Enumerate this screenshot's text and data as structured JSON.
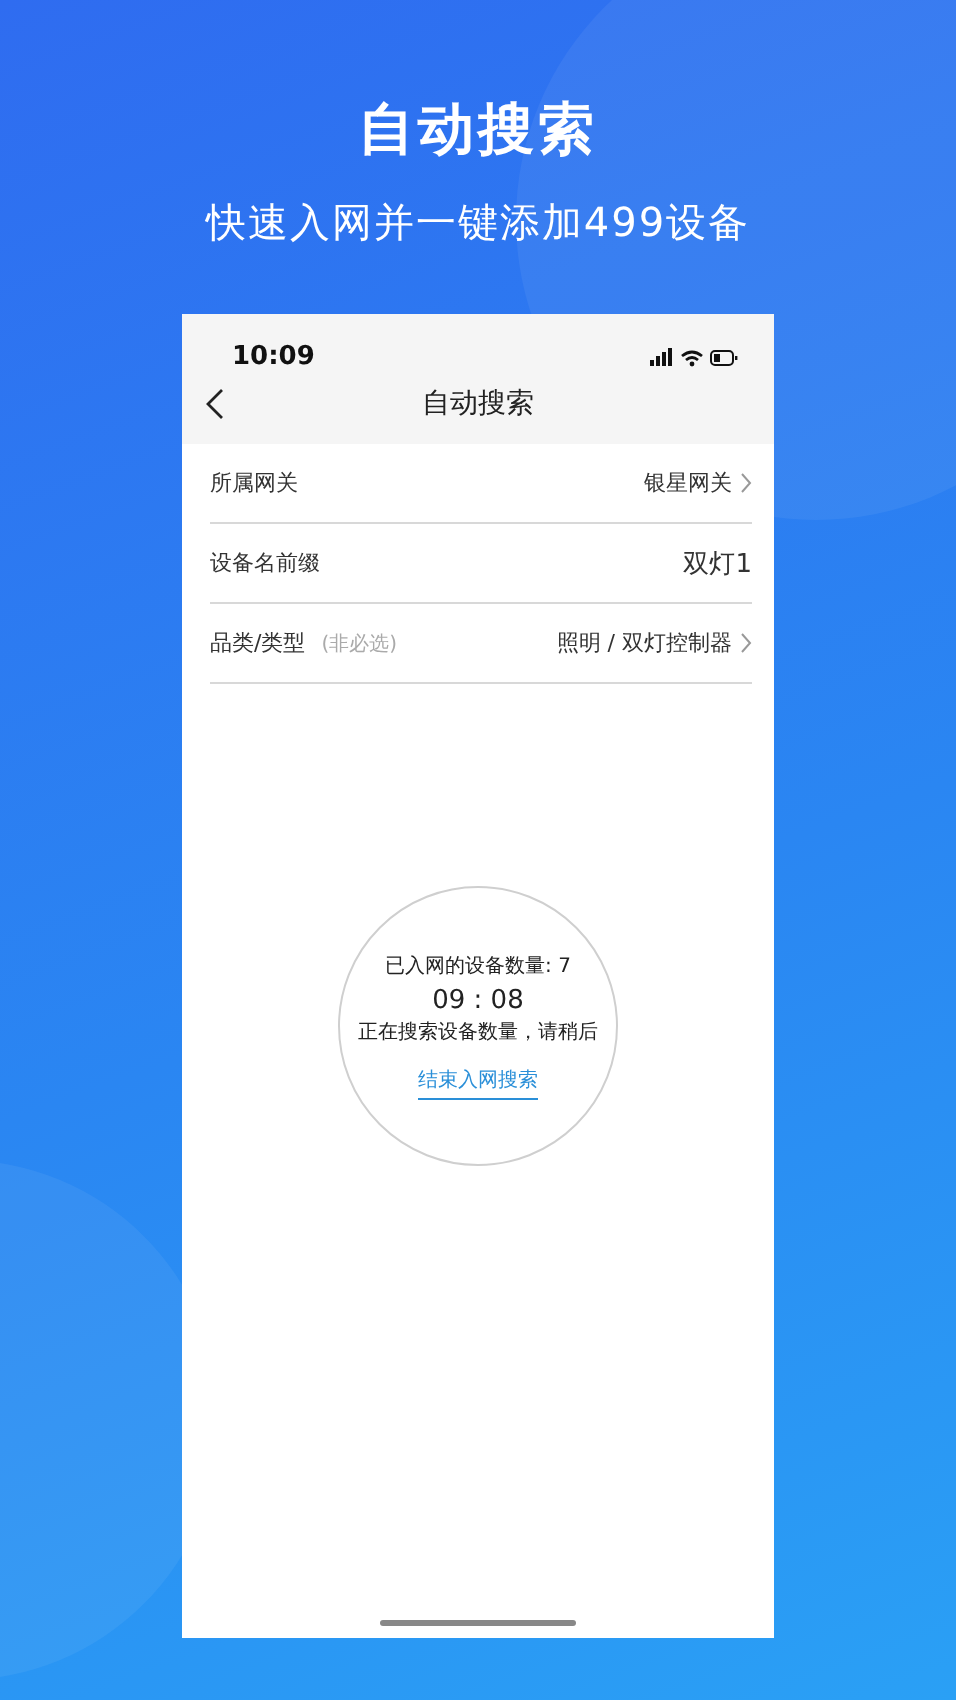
{
  "headline": "自动搜索",
  "subtitle": "快速入网并一键添加499设备",
  "phone": {
    "time": "10:09",
    "title": "自动搜索",
    "rows": [
      {
        "label": "所属网关",
        "value": "银星网关",
        "chevron": true
      },
      {
        "label": "设备名前缀",
        "value": "双灯1",
        "chevron": false
      },
      {
        "label": "品类/类型",
        "hint": "(非必选)",
        "value": "照明 / 双灯控制器",
        "chevron": true
      }
    ],
    "search": {
      "count": "已入网的设备数量: 7",
      "timer": "09 : 08",
      "status": "正在搜索设备数量，请稍后",
      "stop": "结束入网搜索"
    }
  }
}
